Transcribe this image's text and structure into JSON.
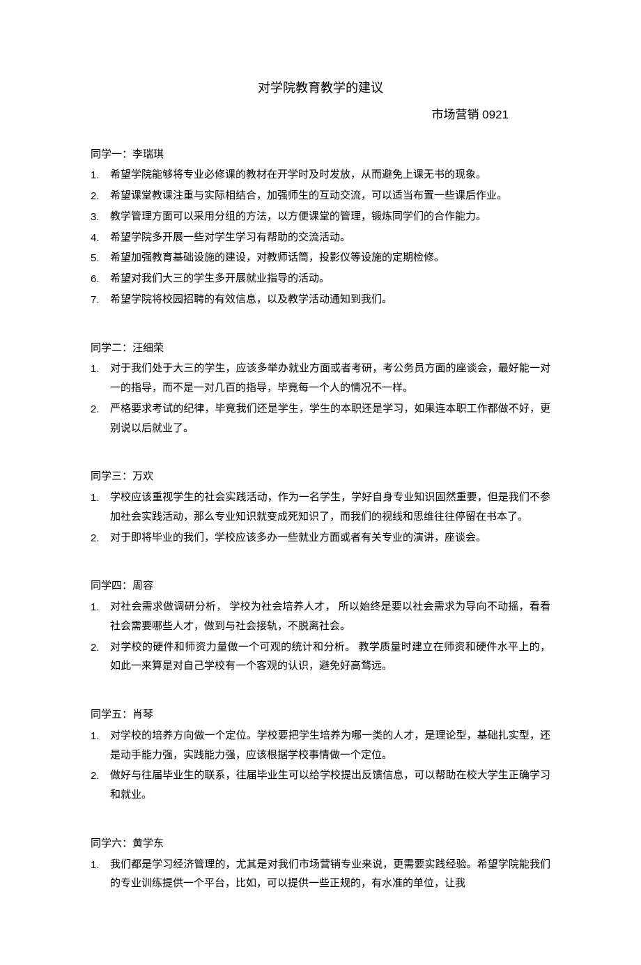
{
  "title": "对学院教育教学的建议",
  "subtitle": "市场营销 0921",
  "students": [
    {
      "name": "同学一：李瑞琪",
      "items": [
        "希望学院能够将专业必修课的教材在开学时及时发放，从而避免上课无书的现象。",
        "希望课堂教课注重与实际相结合，加强师生的互动交流，可以适当布置一些课后作业。",
        "教学管理方面可以采用分组的方法，以方便课堂的管理，锻炼同学们的合作能力。",
        "希望学院多开展一些对学生学习有帮助的交流活动。",
        "希望加强教育基础设施的建设，对教师话筒，投影仪等设施的定期检修。",
        "希望对我们大三的学生多开展就业指导的活动。",
        "希望学院将校园招聘的有效信息，以及教学活动通知到我们。"
      ]
    },
    {
      "name": "同学二：汪细荣",
      "items": [
        "对于我们处于大三的学生，应该多举办就业方面或者考研，考公务员方面的座谈会，最好能一对一的指导，而不是一对几百的指导，毕竟每一个人的情况不一样。",
        "严格要求考试的纪律，毕竟我们还是学生，学生的本职还是学习，如果连本职工作都做不好，更别说以后就业了。"
      ]
    },
    {
      "name": "同学三：万欢",
      "items": [
        "学校应该重视学生的社会实践活动，作为一名学生，学好自身专业知识固然重要，但是我们不参加社会实践活动，那么专业知识就变成死知识了，而我们的视线和思维往往停留在书本了。",
        "对于即将毕业的我们，学校应该多办一些就业方面或者有关专业的演讲，座谈会。"
      ]
    },
    {
      "name": "同学四：周容",
      "items": [
        "对社会需求做调研分析， 学校为社会培养人才， 所以始终是要以社会需求为导向不动摇，看看社会需要哪些人才，做到与社会接轨，不脱离社会。",
        "对学校的硬件和师资力量做一个可观的统计和分析。 教学质量时建立在师资和硬件水平上的，如此一来算是对自己学校有一个客观的认识，避免好高骛远。"
      ]
    },
    {
      "name": "同学五：肖琴",
      "items": [
        "对学校的培养方向做一个定位。学校要把学生培养为哪一类的人才，是理论型，基础扎实型，还是动手能力强，实践能力强，应该根据学校事情做一个定位。",
        "做好与往届毕业生的联系，往届毕业生可以给学校提出反馈信息，可以帮助在校大学生正确学习和就业。"
      ]
    },
    {
      "name": "同学六：黄学东",
      "items": [
        "我们都是学习经济管理的，尤其是对我们市场营销专业来说，更需要实践经验。希望学院能我们的专业训练提供一个平台，比如，可以提供一些正规的，有水准的单位，让我"
      ]
    }
  ]
}
